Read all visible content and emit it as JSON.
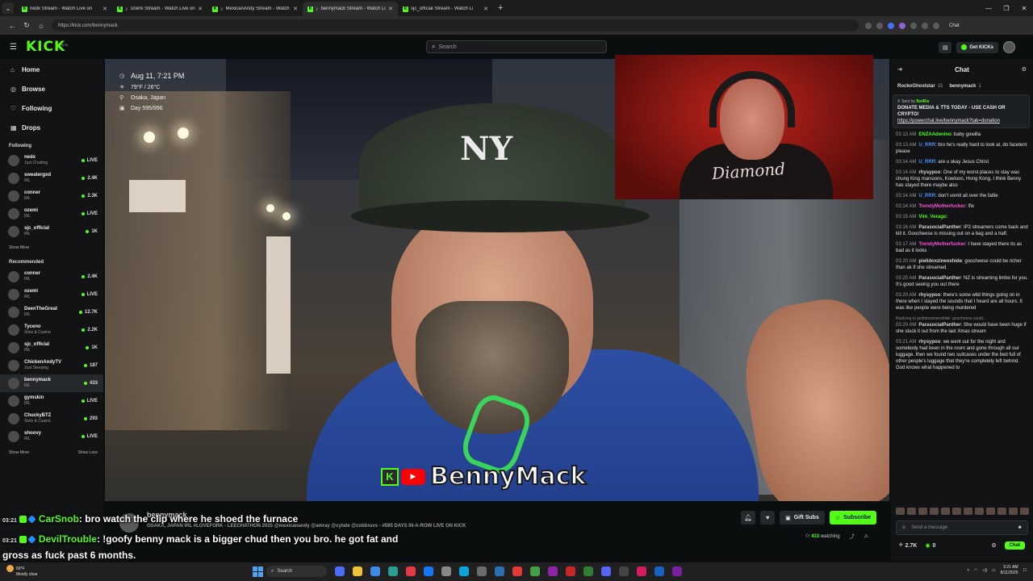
{
  "browser": {
    "tabs": [
      {
        "label": "nedx Stream - Watch Live on",
        "active": false
      },
      {
        "label": "ozemi Stream - Watch Live on",
        "active": false
      },
      {
        "label": "MexicanAndy Stream - Watch",
        "active": false
      },
      {
        "label": "bennymack Stream - Watch Li",
        "active": true
      },
      {
        "label": "sjc_official Stream - Watch Li",
        "active": false
      }
    ],
    "url": "https://kick.com/bennymack",
    "profile_label": "Chat"
  },
  "kick": {
    "logo": "KICK",
    "logo_badge": "BETA",
    "search_placeholder": "Search",
    "get_kicks": "Get KICKs"
  },
  "sidebar": {
    "nav": [
      {
        "icon": "home-icon",
        "glyph": "⌂",
        "label": "Home"
      },
      {
        "icon": "compass-icon",
        "glyph": "◎",
        "label": "Browse"
      },
      {
        "icon": "heart-icon",
        "glyph": "♡",
        "label": "Following"
      },
      {
        "icon": "drops-icon",
        "glyph": "▦",
        "label": "Drops"
      }
    ],
    "following_title": "Following",
    "following": [
      {
        "name": "nedx",
        "category": "Just Chatting",
        "value": "LIVE",
        "dot": true
      },
      {
        "name": "sweatergxd",
        "category": "IRL",
        "value": "2.4K",
        "dot": true
      },
      {
        "name": "conner",
        "category": "IRL",
        "value": "2.3K",
        "dot": true
      },
      {
        "name": "ozemi",
        "category": "IRL",
        "value": "LIVE",
        "dot": true
      },
      {
        "name": "sjc_official",
        "category": "IRL",
        "value": "1K",
        "dot": true
      }
    ],
    "show_more_1": "Show More",
    "recommended_title": "Recommended",
    "recommended": [
      {
        "name": "conner",
        "category": "IRL",
        "value": "2.4K",
        "dot": true
      },
      {
        "name": "ozemi",
        "category": "IRL",
        "value": "LIVE",
        "dot": true
      },
      {
        "name": "DeenTheGreat",
        "category": "IRL",
        "value": "12.7K",
        "dot": true
      },
      {
        "name": "Tyceno",
        "category": "Slots & Casino",
        "value": "2.2K",
        "dot": true
      },
      {
        "name": "sjc_official",
        "category": "IRL",
        "value": "1K",
        "dot": true
      },
      {
        "name": "ChickenAndyTV",
        "category": "Just Sleeping",
        "value": "187",
        "dot": true
      },
      {
        "name": "bennymack",
        "category": "IRL",
        "value": "433",
        "dot": true,
        "selected": true
      },
      {
        "name": "gymskin",
        "category": "IRL",
        "value": "LIVE",
        "dot": true
      },
      {
        "name": "ChuckyBTZ",
        "category": "Slots & Casino",
        "value": "293",
        "dot": true
      },
      {
        "name": "shoovy",
        "category": "IRL",
        "value": "LIVE",
        "dot": true
      }
    ],
    "show_more_2": "Show More",
    "show_less": "Show Less"
  },
  "video_overlay": {
    "date": "Aug 11, 7:21 PM",
    "weather": "79°F / 26°C",
    "location": "Osaka, Japan",
    "day": "Day 595/996",
    "cap_logo": "NY",
    "watermark": "BennyMack",
    "watermark_k": "K",
    "watermark_yt": "▶",
    "cam_shirt": "Diamond"
  },
  "overlay_chat": [
    {
      "time": "03:21",
      "user": "CarSnob",
      "text": ": bro watch the clip where he shoed the furnace"
    },
    {
      "time": "03:21",
      "user": "DevilTrouble",
      "text": ": !goofy benny mack is a bigger chud then you bro. he got fat and"
    },
    {
      "time": "",
      "user": "",
      "text": "gross as fuck past 6 months."
    }
  ],
  "stream_info": {
    "channel": "bennymack",
    "title": "OSAKA, JAPAN IRL #LOVEFORK - LEECHATHON 2025 @mexicanandy @amray @cytate @cobbruvs - #595 DAYS IN-A-ROW LIVE ON KICK",
    "gift_subs": "Gift Subs",
    "subscribe": "Subscribe",
    "viewers": "433",
    "watching_label": "watching"
  },
  "chat": {
    "title": "Chat",
    "pinned_top": [
      {
        "name": "RockoGhoststar",
        "gift": "15"
      },
      {
        "name": "bennymack",
        "gift": "1"
      }
    ],
    "pinned": {
      "sent_by_label": "Sent by",
      "sent_by": "BotRix",
      "text": "DONATE MEDIA & TTS TODAY - USE CASH OR CRYPTO!",
      "link": "https://powerchat.live/bennymack?tab=donation"
    },
    "messages": [
      {
        "time": "03:13 AM",
        "user": "ENZAAdenino",
        "color": "#53fc18",
        "text": ": baby gowilla"
      },
      {
        "time": "03:13 AM",
        "user": "U_RRR",
        "color": "#4f8ff7",
        "text": ": bro he's really hard to look at, do facetent please"
      },
      {
        "time": "03:14 AM",
        "user": "U_RRR",
        "color": "#4f8ff7",
        "text": ": are u okay Jesus Christ"
      },
      {
        "time": "03:14 AM",
        "user": "rhysypoo",
        "color": "#d7d7d7",
        "text": ": One of my worst places to stay was chung King mansions, Kowloon, Hong Kong. I think Benny has stayed there maybe also"
      },
      {
        "time": "03:14 AM",
        "user": "U_RRR",
        "color": "#4f8ff7",
        "text": ": don't vomit all over the fatlie"
      },
      {
        "time": "03:14 AM",
        "user": "TrendyMotherfucker",
        "color": "#ff4fd8",
        "text": ": !fix"
      },
      {
        "time": "03:15 AM",
        "user": "Vim_Verago",
        "color": "#53fc18",
        "text": ":"
      },
      {
        "time": "03:16 AM",
        "user": "ParasocialPanther",
        "color": "#d7d7d7",
        "text": ": IP2 streamers come back and kill it. Goocheese is missing out on a bag and a half."
      },
      {
        "time": "03:17 AM",
        "user": "TrendyMotherfucker",
        "color": "#ff4fd8",
        "text": ": I have stayed there its as bad as it looks"
      },
      {
        "time": "03:20 AM",
        "user": "pielidoxzineoxhide",
        "color": "#d7d7d7",
        "text": ": goocheese could be richer than ak if she streamed"
      },
      {
        "time": "03:20 AM",
        "user": "ParasocialPanther",
        "color": "#d7d7d7",
        "text": ": NZ is streaming limbo for you. It's good seeing you out there"
      },
      {
        "time": "03:20 AM",
        "user": "rhysypoo",
        "color": "#d7d7d7",
        "text": ": there's some wild things going on in there when I stayed the sounds that I heard are all hours. It was like people were being murdered"
      },
      {
        "time": "03:20 AM",
        "user": "ParasocialPanther",
        "color": "#d7d7d7",
        "reply": "Replying to pielidoxzineoxhide: goocheese could...",
        "text": ": She would have been huge if she stuck it out from the last Xmas stream"
      },
      {
        "time": "03:21 AM",
        "user": "rhysypoo",
        "color": "#d7d7d7",
        "text": ": we went out for the night and somebody had been in the room and gone through all our luggage. then we found two suitcases under the bed full of other people's luggage that they're completely left behind. God knows what happened to"
      }
    ],
    "input_placeholder": "Send a message",
    "kicks_count": "2.7K",
    "points": "0",
    "chat_button": "Chat"
  },
  "taskbar": {
    "temp": "69°F",
    "condition": "Mostly clear",
    "search": "Search",
    "time": "3:21 AM",
    "date": "8/11/2025"
  }
}
